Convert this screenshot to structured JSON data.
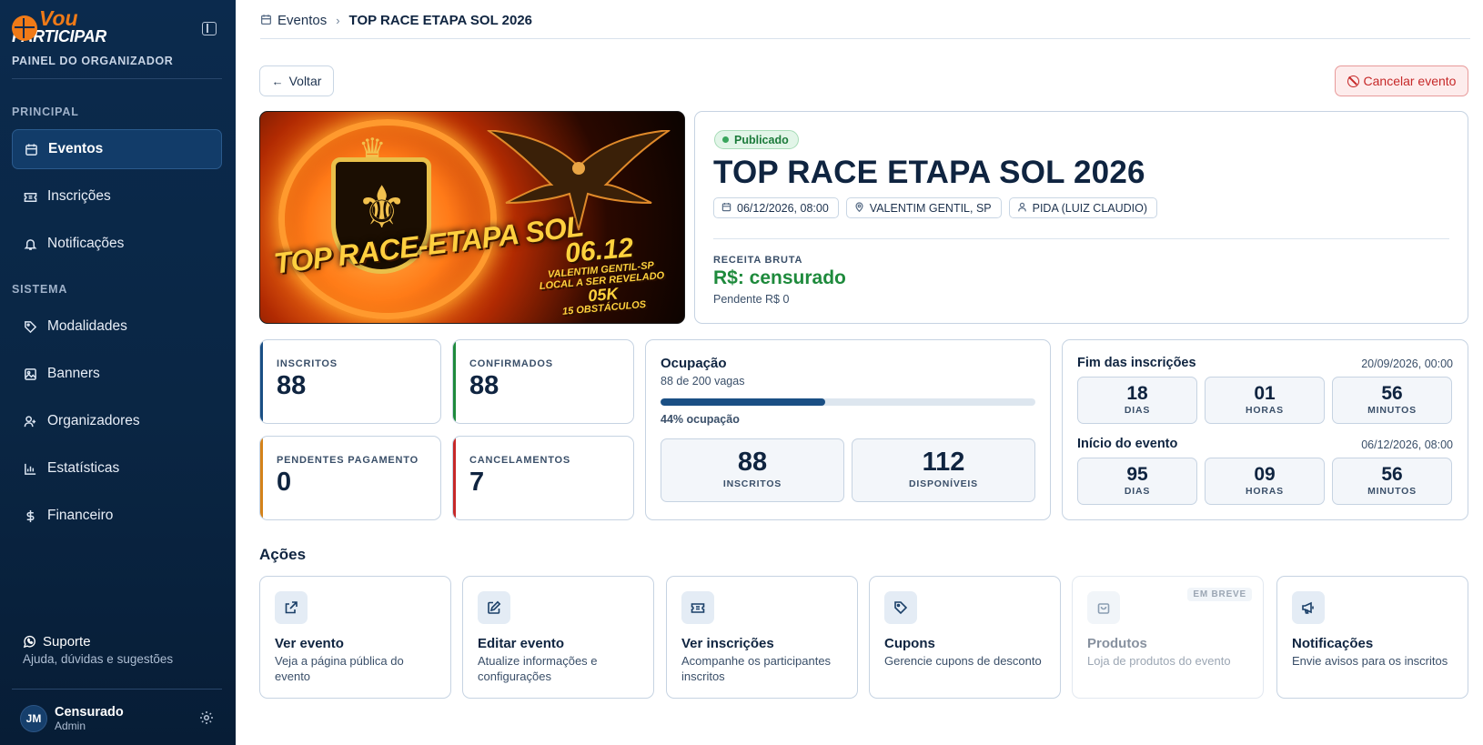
{
  "sidebar": {
    "logo": {
      "line1": "Vou",
      "line2": "PARTICIPAR"
    },
    "subtitle": "PAINEL DO ORGANIZADOR",
    "sections": {
      "principal": "PRINCIPAL",
      "sistema": "SISTEMA"
    },
    "items": [
      {
        "label": "Eventos",
        "icon": "calendar-icon",
        "active": true
      },
      {
        "label": "Inscrições",
        "icon": "ticket-icon"
      },
      {
        "label": "Notificações",
        "icon": "bell-icon"
      },
      {
        "label": "Modalidades",
        "icon": "tag-icon"
      },
      {
        "label": "Banners",
        "icon": "image-icon"
      },
      {
        "label": "Organizadores",
        "icon": "user-icon"
      },
      {
        "label": "Estatísticas",
        "icon": "bar-chart-icon"
      },
      {
        "label": "Financeiro",
        "icon": "dollar-icon"
      }
    ],
    "support": {
      "title": "Suporte",
      "subtitle": "Ajuda, dúvidas e sugestões"
    },
    "user": {
      "initials": "JM",
      "name": "Censurado",
      "role": "Admin"
    }
  },
  "breadcrumb": {
    "parent": "Eventos",
    "current": "TOP RACE ETAPA SOL 2026"
  },
  "buttons": {
    "back": "Voltar",
    "cancel": "Cancelar evento"
  },
  "banner": {
    "title": "TOP RACE-ETAPA SOL",
    "date": "06.12",
    "place": "VALENTIM GENTIL-SP",
    "local": "LOCAL A SER REVELADO",
    "distance": "05K",
    "obstacles": "15 OBSTÁCULOS"
  },
  "event": {
    "status": "Publicado",
    "title": "TOP RACE ETAPA SOL 2026",
    "date": "06/12/2026, 08:00",
    "location": "VALENTIM GENTIL, SP",
    "organizer": "PIDA (LUIZ CLAUDIO)",
    "revenue_label": "RECEITA BRUTA",
    "revenue_value": "R$: censurado",
    "pending": "Pendente R$ 0"
  },
  "stats": [
    {
      "label": "INSCRITOS",
      "value": "88",
      "color": "#1a4f84"
    },
    {
      "label": "CONFIRMADOS",
      "value": "88",
      "color": "#1e8a3c"
    },
    {
      "label": "PENDENTES PAGAMENTO",
      "value": "0",
      "color": "#d4821a"
    },
    {
      "label": "CANCELAMENTOS",
      "value": "7",
      "color": "#c62828"
    }
  ],
  "occupation": {
    "title": "Ocupação",
    "subtitle": "88 de 200 vagas",
    "percent": 44,
    "percent_label": "44% ocupação",
    "registered": {
      "value": "88",
      "label": "INSCRITOS"
    },
    "available": {
      "value": "112",
      "label": "DISPONÍVEIS"
    }
  },
  "countdowns": [
    {
      "title": "Fim das inscrições",
      "date": "20/09/2026, 00:00",
      "units": [
        {
          "n": "18",
          "l": "DIAS"
        },
        {
          "n": "01",
          "l": "HORAS"
        },
        {
          "n": "56",
          "l": "MINUTOS"
        }
      ]
    },
    {
      "title": "Início do evento",
      "date": "06/12/2026, 08:00",
      "units": [
        {
          "n": "95",
          "l": "DIAS"
        },
        {
          "n": "09",
          "l": "HORAS"
        },
        {
          "n": "56",
          "l": "MINUTOS"
        }
      ]
    }
  ],
  "actions": {
    "title": "Ações",
    "items": [
      {
        "title": "Ver evento",
        "desc": "Veja a página pública do evento",
        "icon": "external-link-icon"
      },
      {
        "title": "Editar evento",
        "desc": "Atualize informações e configurações",
        "icon": "edit-icon"
      },
      {
        "title": "Ver inscrições",
        "desc": "Acompanhe os participantes inscritos",
        "icon": "ticket-icon"
      },
      {
        "title": "Cupons",
        "desc": "Gerencie cupons de desconto",
        "icon": "tag-icon"
      },
      {
        "title": "Produtos",
        "desc": "Loja de produtos do evento",
        "icon": "shopping-bag-icon",
        "badge": "EM BREVE"
      },
      {
        "title": "Notificações",
        "desc": "Envie avisos para os inscritos",
        "icon": "megaphone-icon"
      }
    ]
  }
}
